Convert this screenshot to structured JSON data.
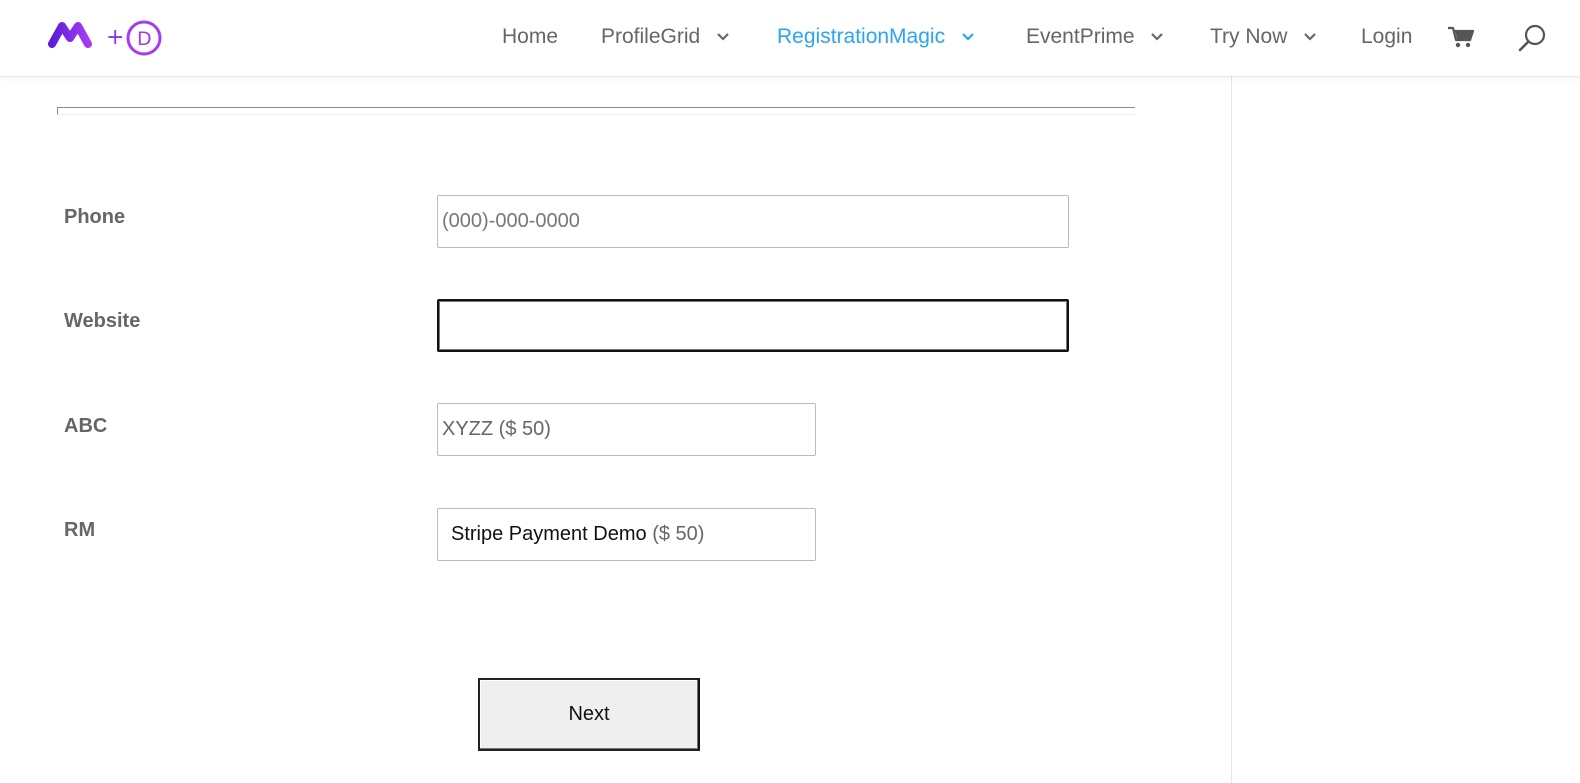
{
  "brand": {
    "logo_name": "metagauss-divi-logo",
    "accent_color": "#2ea3f2",
    "logo_colors": [
      "#7b2ff7",
      "#b33cf5"
    ]
  },
  "nav": {
    "items": [
      {
        "label": "Home",
        "has_dropdown": false,
        "active": false
      },
      {
        "label": "ProfileGrid",
        "has_dropdown": true,
        "active": false
      },
      {
        "label": "RegistrationMagic",
        "has_dropdown": true,
        "active": true
      },
      {
        "label": "EventPrime",
        "has_dropdown": true,
        "active": false
      },
      {
        "label": "Try Now",
        "has_dropdown": true,
        "active": false
      },
      {
        "label": "Login",
        "has_dropdown": false,
        "active": false
      }
    ],
    "icons": [
      "cart-icon",
      "search-icon"
    ]
  },
  "form": {
    "phone": {
      "label": "Phone",
      "placeholder": "(000)-000-0000",
      "value": ""
    },
    "website": {
      "label": "Website",
      "value": ""
    },
    "abc": {
      "label": "ABC",
      "selected": "XYZZ ($ 50)"
    },
    "rm": {
      "label": "RM",
      "selected_name": "Stripe Payment Demo",
      "selected_price": "($ 50)"
    },
    "next_label": "Next"
  }
}
